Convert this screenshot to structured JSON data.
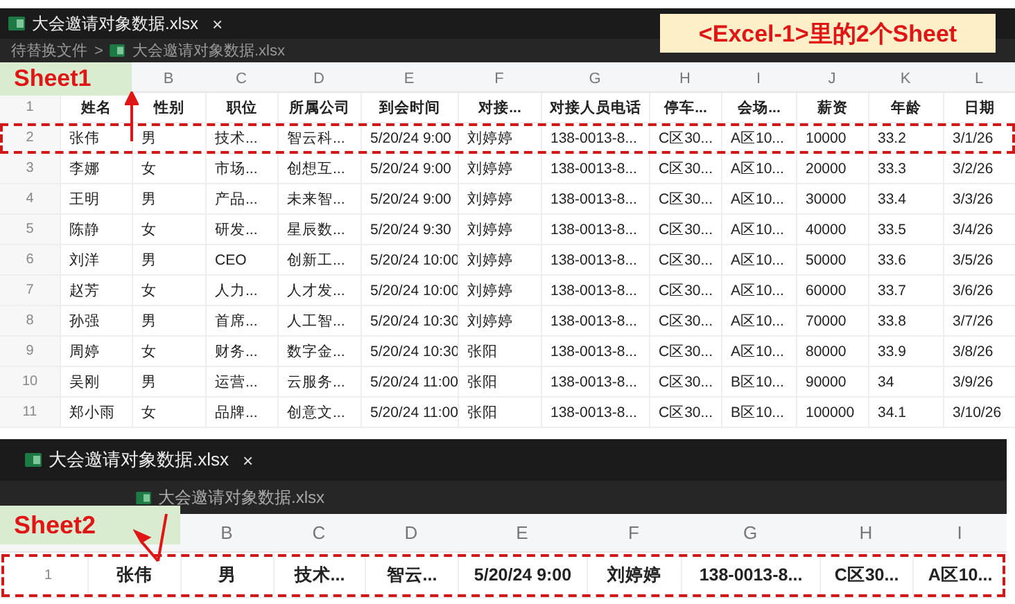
{
  "annotation_title": "<Excel-1>里的2个Sheet",
  "panels": [
    {
      "callout": "Sheet1",
      "tab": {
        "title": "大会邀请对象数据.xlsx",
        "close": "×"
      },
      "breadcrumb_separator": ">",
      "breadcrumb": [
        {
          "text": "待替换文件",
          "kind": "folder"
        },
        {
          "text": "大会邀请对象数据.xlsx",
          "kind": "file"
        }
      ],
      "columns": [
        "",
        "B",
        "C",
        "D",
        "E",
        "F",
        "G",
        "H",
        "I",
        "J",
        "K",
        "L"
      ],
      "rows": [
        {
          "number": "1",
          "bold": true,
          "boxed": false,
          "cells": [
            "姓名",
            "性别",
            "职位",
            "所属公司",
            "到会时间",
            "对接...",
            "对接人员电话",
            "停车...",
            "会场...",
            "薪资",
            "年龄",
            "日期"
          ]
        },
        {
          "number": "2",
          "bold": false,
          "boxed": true,
          "cells": [
            "张伟",
            "男",
            "技术...",
            "智云科...",
            "5/20/24 9:00",
            "刘婷婷",
            "138-0013-8...",
            "C区30...",
            "A区10...",
            "10000",
            "33.2",
            "3/1/26"
          ]
        },
        {
          "number": "3",
          "bold": false,
          "boxed": false,
          "cells": [
            "李娜",
            "女",
            "市场...",
            "创想互...",
            "5/20/24 9:00",
            "刘婷婷",
            "138-0013-8...",
            "C区30...",
            "A区10...",
            "20000",
            "33.3",
            "3/2/26"
          ]
        },
        {
          "number": "4",
          "bold": false,
          "boxed": false,
          "cells": [
            "王明",
            "男",
            "产品...",
            "未来智...",
            "5/20/24 9:00",
            "刘婷婷",
            "138-0013-8...",
            "C区30...",
            "A区10...",
            "30000",
            "33.4",
            "3/3/26"
          ]
        },
        {
          "number": "5",
          "bold": false,
          "boxed": false,
          "cells": [
            "陈静",
            "女",
            "研发...",
            "星辰数...",
            "5/20/24 9:30",
            "刘婷婷",
            "138-0013-8...",
            "C区30...",
            "A区10...",
            "40000",
            "33.5",
            "3/4/26"
          ]
        },
        {
          "number": "6",
          "bold": false,
          "boxed": false,
          "cells": [
            "刘洋",
            "男",
            "CEO",
            "创新工...",
            "5/20/24 10:00",
            "刘婷婷",
            "138-0013-8...",
            "C区30...",
            "A区10...",
            "50000",
            "33.6",
            "3/5/26"
          ]
        },
        {
          "number": "7",
          "bold": false,
          "boxed": false,
          "cells": [
            "赵芳",
            "女",
            "人力...",
            "人才发...",
            "5/20/24 10:00",
            "刘婷婷",
            "138-0013-8...",
            "C区30...",
            "A区10...",
            "60000",
            "33.7",
            "3/6/26"
          ]
        },
        {
          "number": "8",
          "bold": false,
          "boxed": false,
          "cells": [
            "孙强",
            "男",
            "首席...",
            "人工智...",
            "5/20/24 10:30",
            "刘婷婷",
            "138-0013-8...",
            "C区30...",
            "A区10...",
            "70000",
            "33.8",
            "3/7/26"
          ]
        },
        {
          "number": "9",
          "bold": false,
          "boxed": false,
          "cells": [
            "周婷",
            "女",
            "财务...",
            "数字金...",
            "5/20/24 10:30",
            "张阳",
            "138-0013-8...",
            "C区30...",
            "A区10...",
            "80000",
            "33.9",
            "3/8/26"
          ]
        },
        {
          "number": "10",
          "bold": false,
          "boxed": false,
          "cells": [
            "吴刚",
            "男",
            "运营...",
            "云服务...",
            "5/20/24 11:00",
            "张阳",
            "138-0013-8...",
            "C区30...",
            "B区10...",
            "90000",
            "34",
            "3/9/26"
          ]
        },
        {
          "number": "11",
          "bold": false,
          "boxed": false,
          "cells": [
            "郑小雨",
            "女",
            "品牌...",
            "创意文...",
            "5/20/24 11:00",
            "张阳",
            "138-0013-8...",
            "C区30...",
            "B区10...",
            "100000",
            "34.1",
            "3/10/26"
          ]
        }
      ]
    },
    {
      "callout": "Sheet2",
      "tab": {
        "title": "大会邀请对象数据.xlsx",
        "close": "×"
      },
      "breadcrumb": [
        {
          "text": "大会邀请对象数据.xlsx",
          "kind": "file"
        }
      ],
      "columns": [
        "",
        "B",
        "C",
        "D",
        "E",
        "F",
        "G",
        "H",
        "I"
      ],
      "rows": [
        {
          "number": "1",
          "bold": true,
          "boxed": true,
          "cells": [
            "张伟",
            "男",
            "技术...",
            "智云...",
            "5/20/24 9:00",
            "刘婷婷",
            "138-0013-8...",
            "C区30...",
            "A区10..."
          ]
        }
      ]
    }
  ]
}
